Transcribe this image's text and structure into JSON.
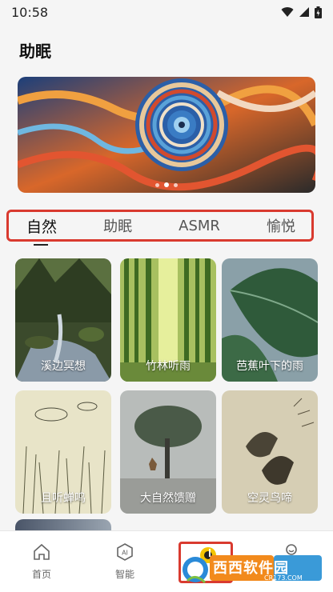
{
  "status_bar": {
    "time": "10:58"
  },
  "header": {
    "title": "助眠"
  },
  "banner": {
    "dot_count": 3,
    "active_dot": 1
  },
  "tabs": [
    {
      "label": "自然",
      "active": true
    },
    {
      "label": "助眠",
      "active": false
    },
    {
      "label": "ASMR",
      "active": false
    },
    {
      "label": "愉悦",
      "active": false
    }
  ],
  "cards": [
    {
      "label": "溪边冥想"
    },
    {
      "label": "竹林听雨"
    },
    {
      "label": "芭蕉叶下的雨"
    },
    {
      "label": "且听蝉鸣"
    },
    {
      "label": "大自然馈赠"
    },
    {
      "label": "空灵鸟啼"
    }
  ],
  "bottom_nav": {
    "home_label": "首页",
    "ai_label": "智能"
  },
  "watermark": {
    "text": "西西软件园",
    "sub": "CR173.COM"
  },
  "colors": {
    "highlight": "#d93a2f",
    "background": "#f5f5f5"
  }
}
